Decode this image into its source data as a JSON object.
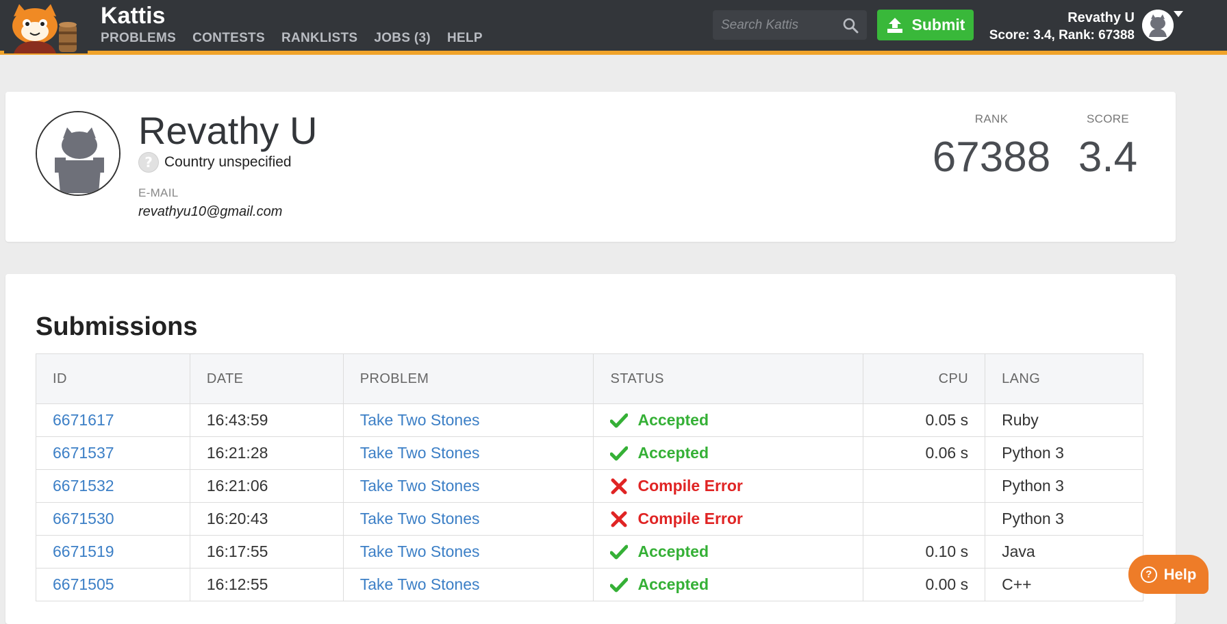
{
  "header": {
    "brand": "Kattis",
    "nav": [
      "PROBLEMS",
      "CONTESTS",
      "RANKLISTS",
      "JOBS (3)",
      "HELP"
    ],
    "search_placeholder": "Search Kattis",
    "submit_label": "Submit",
    "user_name": "Revathy U",
    "user_score_line": "Score: 3.4, Rank: 67388"
  },
  "profile": {
    "name": "Revathy U",
    "country": "Country unspecified",
    "country_icon": "?",
    "email_label": "E-MAIL",
    "email": "revathyu10@gmail.com",
    "rank_label": "RANK",
    "rank_value": "67388",
    "score_label": "SCORE",
    "score_value": "3.4"
  },
  "submissions": {
    "title": "Submissions",
    "columns": [
      "ID",
      "DATE",
      "PROBLEM",
      "STATUS",
      "CPU",
      "LANG"
    ],
    "rows": [
      {
        "id": "6671617",
        "date": "16:43:59",
        "problem": "Take Two Stones",
        "status": "Accepted",
        "status_kind": "ok",
        "cpu": "0.05 s",
        "lang": "Ruby"
      },
      {
        "id": "6671537",
        "date": "16:21:28",
        "problem": "Take Two Stones",
        "status": "Accepted",
        "status_kind": "ok",
        "cpu": "0.06 s",
        "lang": "Python 3"
      },
      {
        "id": "6671532",
        "date": "16:21:06",
        "problem": "Take Two Stones",
        "status": "Compile Error",
        "status_kind": "err",
        "cpu": "",
        "lang": "Python 3"
      },
      {
        "id": "6671530",
        "date": "16:20:43",
        "problem": "Take Two Stones",
        "status": "Compile Error",
        "status_kind": "err",
        "cpu": "",
        "lang": "Python 3"
      },
      {
        "id": "6671519",
        "date": "16:17:55",
        "problem": "Take Two Stones",
        "status": "Accepted",
        "status_kind": "ok",
        "cpu": "0.10 s",
        "lang": "Java"
      },
      {
        "id": "6671505",
        "date": "16:12:55",
        "problem": "Take Two Stones",
        "status": "Accepted",
        "status_kind": "ok",
        "cpu": "0.00 s",
        "lang": "C++"
      }
    ]
  },
  "help_button": {
    "label": "Help",
    "icon": "?"
  },
  "colors": {
    "topbar": "#33363a",
    "accent_bar": "#f0a32a",
    "submit_green": "#39b83a",
    "accepted": "#35b036",
    "error": "#e02424",
    "link": "#3c7fc6",
    "help_orange": "#ee7c28"
  },
  "icons": {
    "search": "search-icon",
    "submit": "upload-icon",
    "accepted": "check-icon",
    "error": "cross-icon",
    "help": "question-circle-icon"
  }
}
